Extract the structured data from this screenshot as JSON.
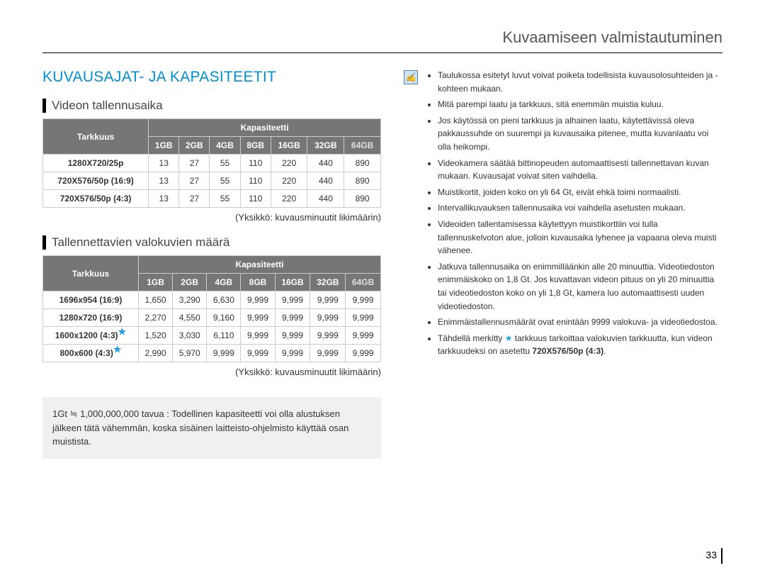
{
  "page_title": "Kuvaamiseen valmistautuminen",
  "section_title": "KUVAUSAJAT- JA KAPASITEETIT",
  "page_number": "33",
  "video": {
    "heading": "Videon tallennusaika",
    "col_tarkkuus": "Tarkkuus",
    "col_kapasiteetti": "Kapasiteetti",
    "caps": [
      "1GB",
      "2GB",
      "4GB",
      "8GB",
      "16GB",
      "32GB",
      "64GB"
    ],
    "rows": [
      {
        "label": "1280X720/25p",
        "v": [
          "13",
          "27",
          "55",
          "110",
          "220",
          "440",
          "890"
        ]
      },
      {
        "label": "720X576/50p (16:9)",
        "v": [
          "13",
          "27",
          "55",
          "110",
          "220",
          "440",
          "890"
        ]
      },
      {
        "label": "720X576/50p (4:3)",
        "v": [
          "13",
          "27",
          "55",
          "110",
          "220",
          "440",
          "890"
        ]
      }
    ],
    "unit": "(Yksikkö: kuvausminuutit likimäärin)"
  },
  "photo": {
    "heading": "Tallennettavien valokuvien määrä",
    "col_tarkkuus": "Tarkkuus",
    "col_kapasiteetti": "Kapasiteetti",
    "caps": [
      "1GB",
      "2GB",
      "4GB",
      "8GB",
      "16GB",
      "32GB",
      "64GB"
    ],
    "rows": [
      {
        "label": "1696x954 (16:9)",
        "star": false,
        "v": [
          "1,650",
          "3,290",
          "6,630",
          "9,999",
          "9,999",
          "9,999",
          "9,999"
        ]
      },
      {
        "label": "1280x720 (16:9)",
        "star": false,
        "v": [
          "2,270",
          "4,550",
          "9,160",
          "9,999",
          "9,999",
          "9,999",
          "9,999"
        ]
      },
      {
        "label": "1600x1200 (4:3)",
        "star": true,
        "v": [
          "1,520",
          "3,030",
          "6,110",
          "9,999",
          "9,999",
          "9,999",
          "9,999"
        ]
      },
      {
        "label": "800x600 (4:3)",
        "star": true,
        "v": [
          "2,990",
          "5,970",
          "9,999",
          "9,999",
          "9,999",
          "9,999",
          "9,999"
        ]
      }
    ],
    "unit": "(Yksikkö: kuvausminuutit likimäärin)"
  },
  "gray_note": "1Gt ≒ 1,000,000,000 tavua : Todellinen kapasiteetti voi olla alustuksen jälkeen tätä vähemmän, koska sisäinen laitteisto-ohjelmisto käyttää osan muistista.",
  "notes": [
    "Taulukossa esitetyt luvut voivat poiketa todellisista kuvausolosuhteiden ja -kohteen mukaan.",
    "Mitä parempi laatu ja tarkkuus, sitä enemmän muistia kuluu.",
    "Jos käytössä on pieni tarkkuus ja alhainen laatu, käytettävissä oleva pakkaussuhde on suurempi ja kuvausaika pitenee, mutta kuvanlaatu voi olla heikompi.",
    "Videokamera säätää bittinopeuden automaattisesti tallennettavan kuvan mukaan. Kuvausajat voivat siten vaihdella.",
    "Muistikortit, joiden koko on yli 64 Gt, eivät ehkä toimi normaalisti.",
    "Intervallikuvauksen tallennusaika voi vaihdella asetusten mukaan.",
    "Videoiden tallentamisessa käytettyyn muistikorttiin voi tulla tallennuskelvoton alue, jolloin kuvausaika lyhenee ja vapaana oleva muisti vähenee.",
    "Jatkuva tallennusaika on enimmilläänkin alle 20 minuuttia. Videotiedoston enimmäiskoko on 1,8 Gt. Jos kuvattavan videon pituus on yli 20 minuuttia tai videotiedoston koko on yli 1,8 Gt, kamera luo automaattisesti uuden videotiedoston.",
    "Enimmäistallennusmäärät ovat enintään 9999 valokuva- ja videotiedostoa."
  ],
  "note_star_prefix": "Tähdellä merkitty ",
  "note_star_mid": " tarkkuus tarkoittaa valokuvien tarkkuutta, kun videon tarkkuudeksi on asetettu ",
  "note_star_bold": "720X576/50p (4:3)",
  "note_star_suffix": "."
}
